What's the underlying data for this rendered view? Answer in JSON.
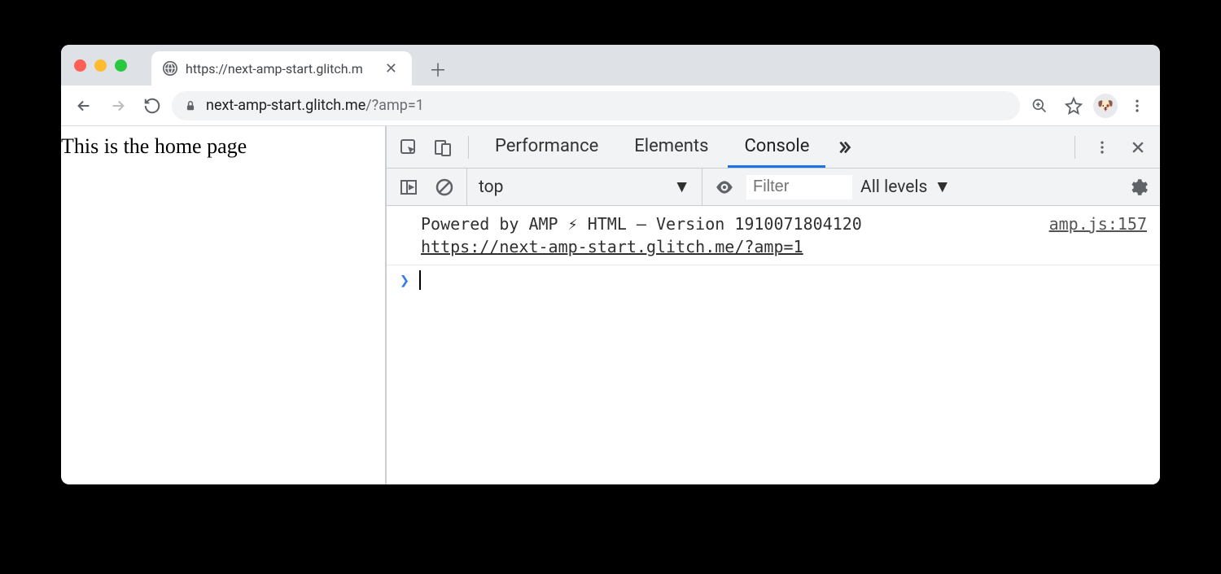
{
  "browser": {
    "tab_title": "https://next-amp-start.glitch.m",
    "url_host": "next-amp-start.glitch.me",
    "url_path": "/?amp=1"
  },
  "page": {
    "body_text": "This is the home page"
  },
  "devtools": {
    "tabs": {
      "performance": "Performance",
      "elements": "Elements",
      "console": "Console"
    },
    "console_toolbar": {
      "context": "top",
      "filter_placeholder": "Filter",
      "levels_label": "All levels"
    },
    "console": {
      "message_line1": "Powered by AMP ⚡ HTML – Version 1910071804120",
      "message_line2": "https://next-amp-start.glitch.me/?amp=1",
      "source": "amp.js:157"
    }
  }
}
